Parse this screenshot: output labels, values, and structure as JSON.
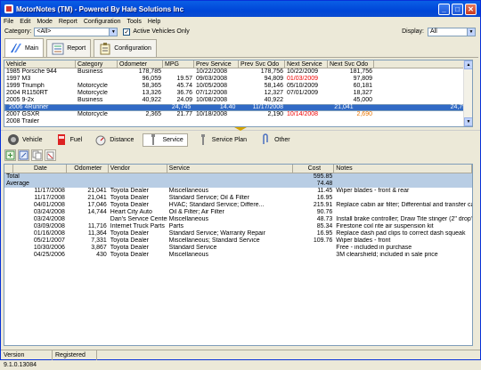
{
  "window": {
    "title": "MotorNotes (TM) - Powered By Hale Solutions Inc"
  },
  "menu": [
    "File",
    "Edit",
    "Mode",
    "Report",
    "Configuration",
    "Tools",
    "Help"
  ],
  "filters": {
    "category_label": "Category:",
    "category_value": "<All>",
    "active_only_label": "Active Vehicles Only",
    "active_only_checked": true,
    "display_label": "Display:",
    "display_value": "All"
  },
  "top_tabs": [
    {
      "label": "Main",
      "active": true
    },
    {
      "label": "Report",
      "active": false
    },
    {
      "label": "Configuration",
      "active": false
    }
  ],
  "vehicles": {
    "columns": [
      "Vehicle",
      "Category",
      "Odometer",
      "MPG",
      "Prev Service",
      "Prev Svc Odo",
      "Next Service",
      "Next Svc Odo"
    ],
    "rows": [
      [
        "1985 Porsche 944",
        "Business",
        "178,785",
        "",
        "10/22/2008",
        "178,756",
        "10/22/2009",
        "181,756"
      ],
      [
        "1997 M3",
        "",
        "96,059",
        "19.57",
        "09/03/2008",
        "94,809",
        "01/03/2009",
        "97,809"
      ],
      [
        "1999 Triumph",
        "Motorcycle",
        "58,365",
        "45.74",
        "10/05/2008",
        "58,146",
        "05/10/2009",
        "60,181"
      ],
      [
        "2004 R1150RT",
        "Motorcycle",
        "13,326",
        "36.76",
        "07/12/2008",
        "12,327",
        "07/01/2009",
        "18,327"
      ],
      [
        "2005 9-2x",
        "Business",
        "40,922",
        "24.09",
        "10/08/2008",
        "40,922",
        "",
        "45,000"
      ],
      [
        "2006 4Runner",
        "",
        "24,745",
        "14.40",
        "11/17/2008",
        "21,041",
        "",
        "24,791"
      ],
      [
        "2007 GSXR",
        "Motorcycle",
        "2,365",
        "21.77",
        "10/18/2008",
        "2,190",
        "10/14/2008",
        "2,690"
      ],
      [
        "2008 Trailer",
        "",
        "",
        "",
        "",
        "",
        "",
        ""
      ]
    ],
    "selected_row": 5,
    "red_cells": [
      [
        1,
        6
      ],
      [
        6,
        6
      ]
    ],
    "orange_cells": [
      [
        6,
        7
      ]
    ]
  },
  "service_tabs": [
    {
      "label": "Vehicle",
      "active": false
    },
    {
      "label": "Fuel",
      "active": false
    },
    {
      "label": "Distance",
      "active": false
    },
    {
      "label": "Service",
      "active": true
    },
    {
      "label": "Service Plan",
      "active": false
    },
    {
      "label": "Other",
      "active": false
    }
  ],
  "services": {
    "columns": [
      "",
      "Date",
      "Odometer",
      "Vendor",
      "Service",
      "Cost",
      "Notes"
    ],
    "totals": [
      {
        "label": "Total",
        "cost": "595.85"
      },
      {
        "label": "Average",
        "cost": "74.48"
      }
    ],
    "rows": [
      [
        "11/17/2008",
        "21,041",
        "Toyota Dealer",
        "Miscellaneous",
        "11.45",
        "Wiper blades - front & rear"
      ],
      [
        "11/17/2008",
        "21,041",
        "Toyota Dealer",
        "Standard Service; Oil & Filter",
        "16.95",
        ""
      ],
      [
        "04/01/2008",
        "17,046",
        "Toyota Dealer",
        "HVAC; Standard Service; Differe...",
        "215.91",
        "Replace cabin air filter; Differential and transfer case fluids"
      ],
      [
        "03/24/2008",
        "14,744",
        "Heart City Auto",
        "Oil & Filter; Air Filter",
        "90.76",
        ""
      ],
      [
        "03/24/2008",
        "",
        "Dan's Service Center",
        "Miscellaneous",
        "48.73",
        "Install brake controller; Draw Tite stinger (2\" drop?)"
      ],
      [
        "03/09/2008",
        "11,716",
        "Internet Truck Parts",
        "Parts",
        "85.34",
        "Firestone coil rite air suspension kit"
      ],
      [
        "01/16/2008",
        "11,364",
        "Toyota Dealer",
        "Standard Service; Warranty Repair",
        "16.95",
        "Replace dash pad clips to correct dash squeak"
      ],
      [
        "05/21/2007",
        "7,331",
        "Toyota Dealer",
        "Miscellaneous; Standard Service",
        "109.76",
        "Wiper blades - front"
      ],
      [
        "10/30/2006",
        "3,867",
        "Toyota Dealer",
        "Standard Service",
        "",
        "Free - included in purchase"
      ],
      [
        "04/25/2006",
        "430",
        "Toyota Dealer",
        "Miscellaneous",
        "",
        "3M clearshield; included in sale price"
      ]
    ]
  },
  "status": {
    "version": "Version 9.1.0.13084",
    "registration": "Registered"
  }
}
